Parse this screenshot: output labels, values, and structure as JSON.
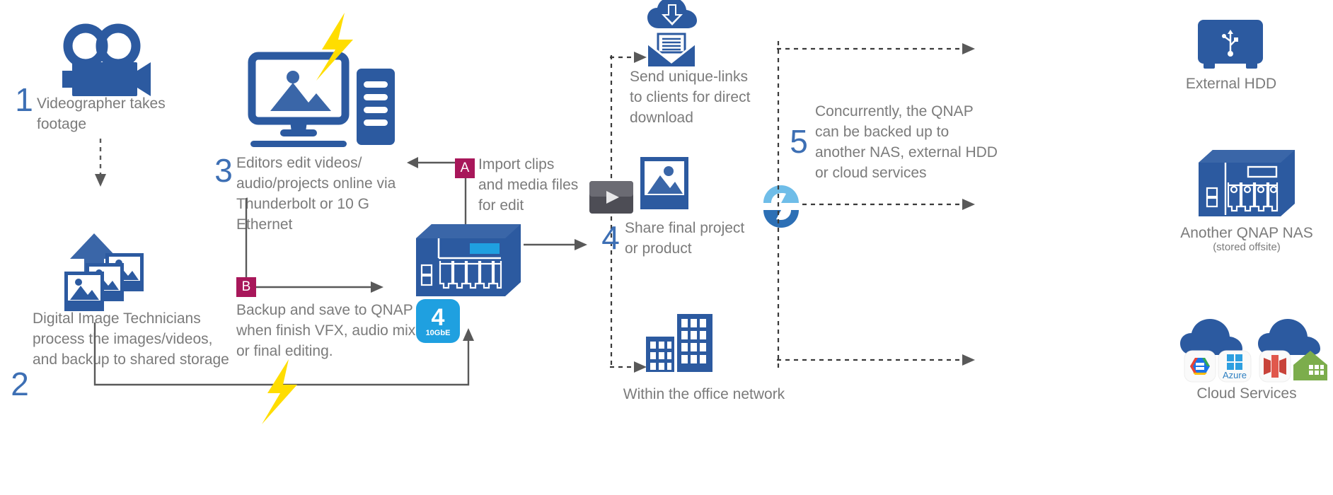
{
  "theme": {
    "blue": "#2c5aa0",
    "blue_dark": "#26508f",
    "step_blue": "#3d6fb4",
    "text_gray": "#7b7b7b",
    "badge_magenta": "#a8175a",
    "cyan": "#1fa0e0",
    "yellow": "#ffdd00",
    "arrow_gray": "#595959"
  },
  "steps": [
    {
      "number": "1",
      "text": "Videographer takes\nfootage",
      "icon": "video-camera-icon"
    },
    {
      "number": "2",
      "text": "Digital Image Technicians\nprocess the images/videos,\nand backup to shared storage",
      "icon": "upload-photos-icon"
    },
    {
      "number": "3",
      "text": "Editors edit videos/\naudio/projects online via\nThunderbolt or 10 G Ethernet",
      "icon": "workstation-icon"
    },
    {
      "number": "4",
      "text": "Share final project\nor product",
      "icon": "share-media-icon"
    },
    {
      "number": "5",
      "text": "Concurrently, the QNAP\ncan be backed up to\nanother NAS, external HDD\nor cloud services",
      "icon": "sync-icon"
    }
  ],
  "badges": [
    {
      "letter": "A",
      "text": "Import clips\nand media files\nfor edit"
    },
    {
      "letter": "B",
      "text": "Backup and save to QNAP\nwhen finish VFX, audio mix,\nor final editing."
    }
  ],
  "nas": {
    "speed_badge_value": "4",
    "speed_badge_unit": "10GbE"
  },
  "branches": {
    "send_links": "Send unique-links\nto clients for direct\ndownload",
    "office_network": "Within the office network"
  },
  "destinations": [
    {
      "label": "External HDD",
      "sub": "",
      "icon": "external-hdd-icon"
    },
    {
      "label": "Another QNAP NAS",
      "sub": "(stored offsite)",
      "icon": "nas-5bay-icon"
    },
    {
      "label": "Cloud Services",
      "sub": "",
      "icon": "cloud-services-icon"
    }
  ],
  "cloud_providers": [
    {
      "name": "Google Cloud Storage",
      "short": ""
    },
    {
      "name": "Azure",
      "short": "Azure"
    },
    {
      "name": "Amazon S3",
      "short": ""
    },
    {
      "name": "HybridMount Home",
      "short": ""
    }
  ]
}
